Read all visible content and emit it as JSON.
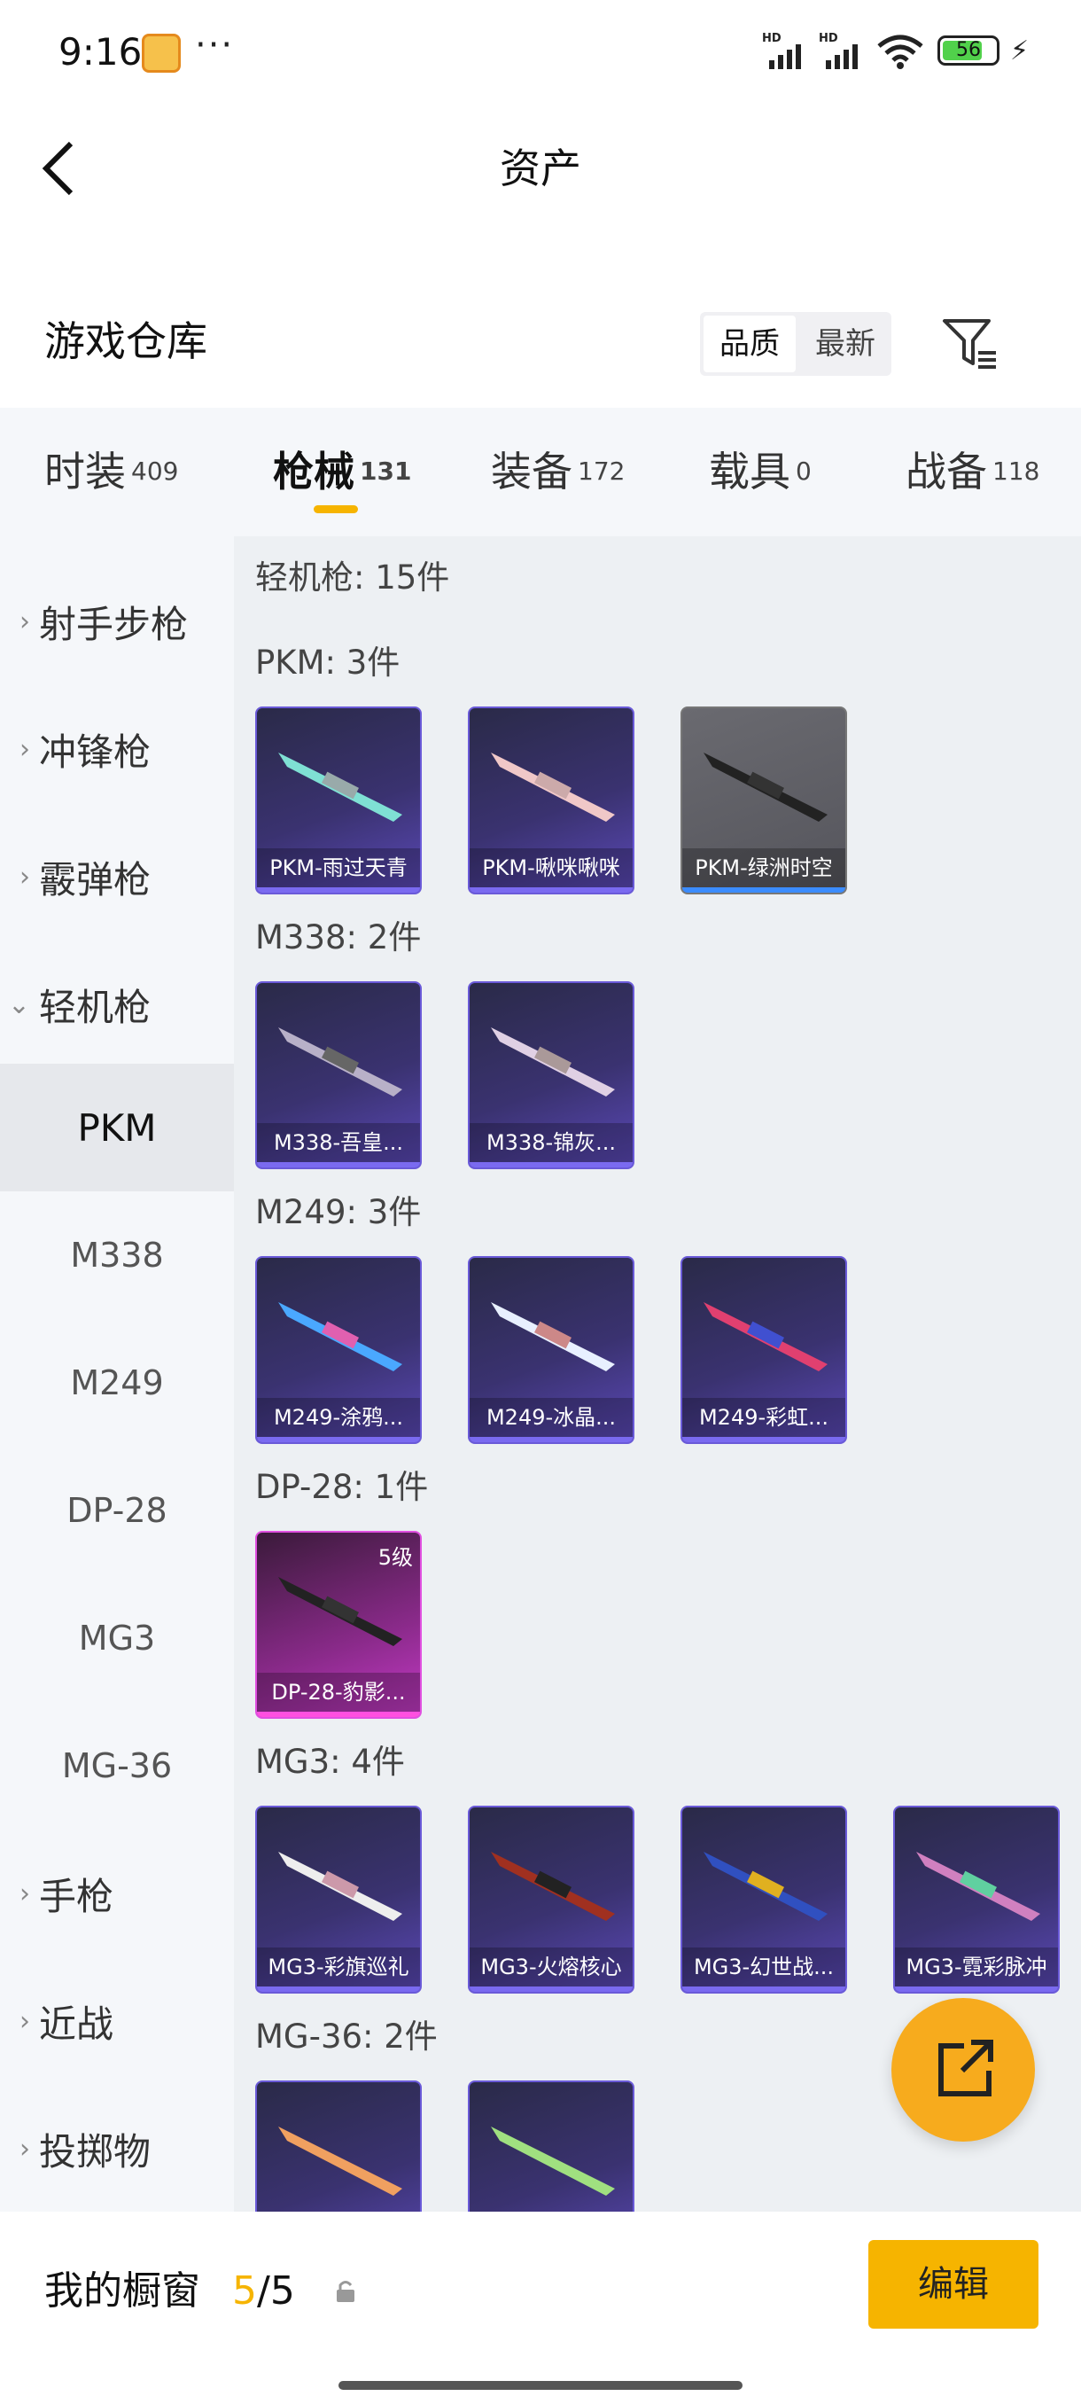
{
  "status_bar": {
    "time": "9:16",
    "dots": "···",
    "battery": "56",
    "signal1": "HD",
    "signal2": "HD"
  },
  "header": {
    "title": "资产"
  },
  "warehouse": {
    "title": "游戏仓库",
    "sort_options": [
      "品质",
      "最新"
    ]
  },
  "tabs": [
    {
      "label": "时装",
      "count": "409"
    },
    {
      "label": "枪械",
      "count": "131"
    },
    {
      "label": "装备",
      "count": "172"
    },
    {
      "label": "载具",
      "count": "0"
    },
    {
      "label": "战备",
      "count": "118"
    }
  ],
  "sidebar": [
    {
      "label": "射手步枪"
    },
    {
      "label": "冲锋枪"
    },
    {
      "label": "霰弹枪"
    },
    {
      "label": "轻机枪"
    },
    {
      "label": "PKM"
    },
    {
      "label": "M338"
    },
    {
      "label": "M249"
    },
    {
      "label": "DP-28"
    },
    {
      "label": "MG3"
    },
    {
      "label": "MG-36"
    },
    {
      "label": "手枪"
    },
    {
      "label": "近战"
    },
    {
      "label": "投掷物"
    }
  ],
  "content": {
    "category_header": "轻机枪: 15件",
    "sections": [
      {
        "title": "PKM: 3件",
        "items": [
          "PKM-雨过天青",
          "PKM-啾咪啾咪",
          "PKM-绿洲时空"
        ]
      },
      {
        "title": "M338: 2件",
        "items": [
          "M338-吾皇...",
          "M338-锦灰..."
        ]
      },
      {
        "title": "M249: 3件",
        "items": [
          "M249-涂鸦...",
          "M249-冰晶...",
          "M249-彩虹..."
        ]
      },
      {
        "title": "DP-28: 1件",
        "items": [
          "DP-28-豹影..."
        ],
        "level": "5级"
      },
      {
        "title": "MG3: 4件",
        "items": [
          "MG3-彩旗巡礼",
          "MG3-火熔核心",
          "MG3-幻世战...",
          "MG3-霓彩脉冲"
        ]
      },
      {
        "title": "MG-36: 2件",
        "items": [
          "",
          ""
        ]
      }
    ]
  },
  "bottom": {
    "title": "我的橱窗",
    "count_current": "5",
    "count_sep": "/",
    "count_total": "5",
    "edit_label": "编辑"
  },
  "colors": {
    "accent": "#f6b400",
    "fab": "#f7ab1d",
    "purple_card": "#3a3270",
    "pink_card": "#c43ac6",
    "grey_card": "#6a6a70"
  }
}
